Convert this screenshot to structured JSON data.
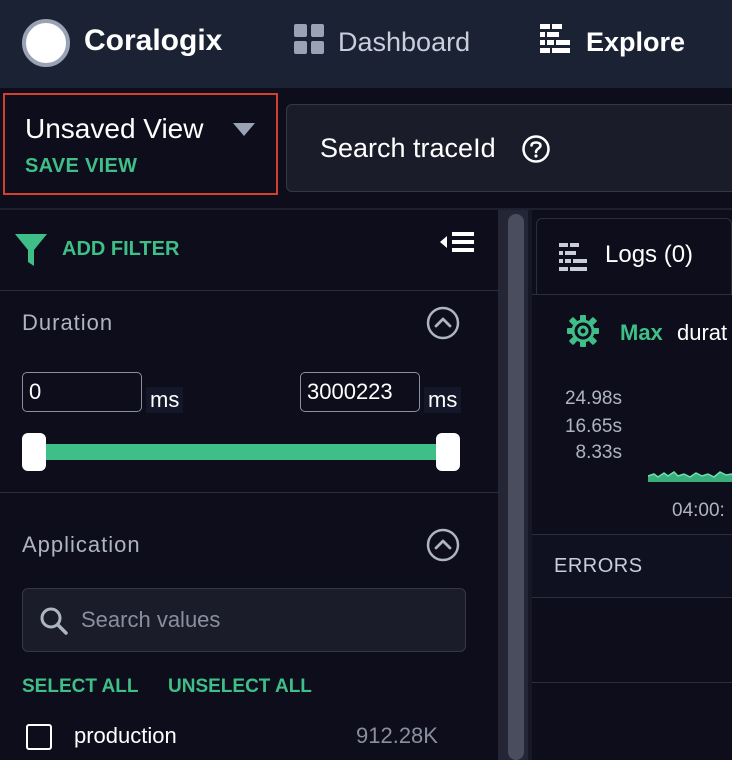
{
  "nav": {
    "brand": "Coralogix",
    "items": [
      {
        "label": "Dashboard",
        "icon": "dashboard-grid-icon"
      },
      {
        "label": "Explore",
        "icon": "explore-icon"
      }
    ]
  },
  "view": {
    "title": "Unsaved View",
    "save_label": "SAVE VIEW"
  },
  "trace_search": {
    "label": "Search traceId",
    "icon": "help-icon"
  },
  "filters": {
    "add_filter_label": "ADD FILTER",
    "duration": {
      "title": "Duration",
      "min_value": "0",
      "max_value": "3000223",
      "unit": "ms",
      "range_fraction": [
        0,
        1
      ]
    },
    "application": {
      "title": "Application",
      "search_placeholder": "Search values",
      "select_all_label": "SELECT ALL",
      "unselect_all_label": "UNSELECT ALL",
      "items": [
        {
          "name": "production",
          "count": "912.28K",
          "checked": false
        }
      ]
    }
  },
  "right": {
    "tab_logs_label": "Logs (0)",
    "metric_agg": "Max",
    "metric_name": "durat",
    "y_ticks": [
      "24.98s",
      "16.65s",
      "8.33s"
    ],
    "x_tick": "04:00:",
    "errors_label": "ERRORS"
  },
  "colors": {
    "accent": "#3fbf87",
    "nav_bg": "#1a2233",
    "page_bg": "#0d0d1b",
    "highlight_border": "#d3402e"
  }
}
